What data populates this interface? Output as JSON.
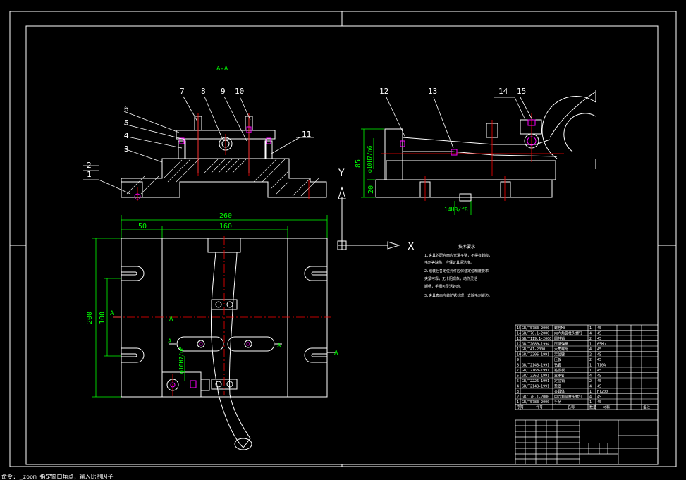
{
  "views": {
    "section_title": "A-A"
  },
  "part_numbers": {
    "left": [
      "1",
      "2",
      "3",
      "4",
      "5",
      "6",
      "7",
      "8",
      "9",
      "10",
      "11"
    ],
    "right": [
      "12",
      "13",
      "14",
      "15"
    ]
  },
  "dimensions": {
    "overall_width": "260",
    "left_offset": "50",
    "span": "160",
    "overall_height": "200",
    "vertical_span": "100",
    "side_height": "85",
    "side_bore": "φ10H7/n6",
    "side_base": "20",
    "side_key": "14H8/f8",
    "plan_fit": "φ10H7/n6"
  },
  "section_marks": {
    "left_mark": "A",
    "right_mark": "A"
  },
  "ucs": {
    "y_label": "Y",
    "x_label": "X"
  },
  "notes": {
    "title": "技术要求",
    "lines": [
      "1.夹具的配合面应光滑平整，不得有划痕，",
      "毛刺等缺陷，应保证其清洁度。",
      "2.组装后各定位元件应保证定位精度要求",
      "夹紧可靠，无卡阻现象，动作灵活",
      "顺畅，手柄可灵活转动。",
      "3.夹具表面应做防锈处理，去除毛刺锐边。"
    ]
  },
  "parts_table": {
    "rows": [
      [
        "15",
        "GB/T5783-2000",
        "螺栓M8",
        "1",
        "45",
        ""
      ],
      [
        "14",
        "GB/T70.1-2000",
        "内六角圆柱头螺钉",
        "4",
        "45",
        ""
      ],
      [
        "13",
        "GB/T119.1-2000",
        "圆柱销",
        "2",
        "45",
        ""
      ],
      [
        "12",
        "GB/T2089-1994",
        "压缩弹簧",
        "1",
        "65Mn",
        ""
      ],
      [
        "11",
        "GB/T41-2000",
        "六角螺母",
        "4",
        "45",
        ""
      ],
      [
        "10",
        "GB/T2206-1991",
        "定位键",
        "2",
        "45",
        ""
      ],
      [
        "9",
        "",
        "压板",
        "2",
        "45",
        ""
      ],
      [
        "8",
        "GB/T2148-1991",
        "钻套",
        "1",
        "T10A",
        ""
      ],
      [
        "7",
        "GB/T2168-1991",
        "钻模板",
        "1",
        "45",
        ""
      ],
      [
        "6",
        "GB/T2262-1991",
        "支承钉",
        "4",
        "45",
        ""
      ],
      [
        "5",
        "GB/T2226-1991",
        "定位销",
        "2",
        "45",
        ""
      ],
      [
        "4",
        "GB/T2148-1991",
        "垫圈",
        "4",
        "45",
        ""
      ],
      [
        "3",
        "",
        "夹具体",
        "1",
        "HT200",
        ""
      ],
      [
        "2",
        "GB/T70.1-2000",
        "内六角圆柱头螺钉",
        "4",
        "45",
        ""
      ],
      [
        "1",
        "GB/T5783-2000",
        "手柄",
        "1",
        "45",
        ""
      ]
    ],
    "header": [
      "序号",
      "代号",
      "名称",
      "数量",
      "材料",
      "备注"
    ]
  },
  "status_bar": "命令: _zoom 指定窗口角点，输入比例因子",
  "colors": {
    "background": "#000000",
    "line": "#ffffff",
    "dimension": "#00ff00",
    "center": "#ff0000",
    "highlight": "#ff00ff"
  }
}
